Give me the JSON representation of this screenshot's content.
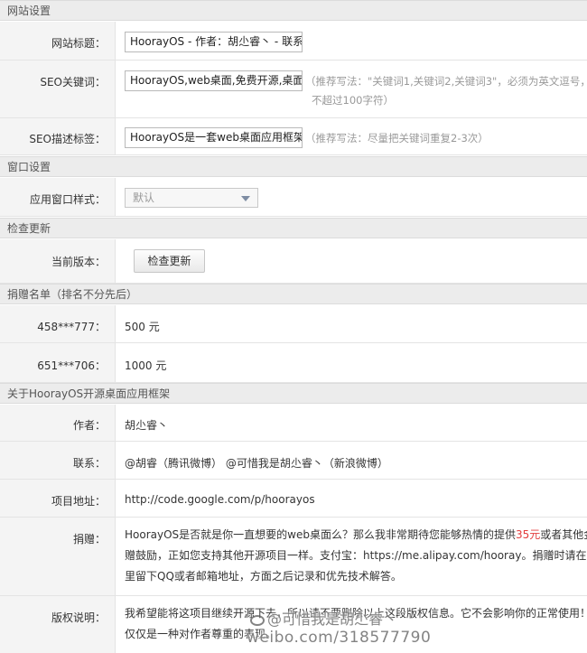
{
  "sections": {
    "site": "网站设置",
    "window": "窗口设置",
    "update": "检查更新",
    "donors": "捐赠名单（排名不分先后）",
    "about": "关于HoorayOS开源桌面应用框架"
  },
  "site": {
    "title_label": "网站标题：",
    "title_value": "HoorayOS - 作者：胡尐睿丶 - 联系方式",
    "keywords_label": "SEO关键词：",
    "keywords_value": "HoorayOS,web桌面,免费开源,桌面管理",
    "keywords_hint_1": "（推荐写法：\"关键词1,关键词2,关键词3\"，必须为英文逗号，",
    "keywords_hint_2": "不超过100字符）",
    "desc_label": "SEO描述标签：",
    "desc_value": "HoorayOS是一套web桌面应用框架，",
    "desc_hint": "（推荐写法：尽量把关键词重复2-3次）"
  },
  "window": {
    "style_label": "应用窗口样式：",
    "style_value": "默认"
  },
  "update": {
    "version_label": "当前版本：",
    "check_button": "检查更新"
  },
  "donors": [
    {
      "name": "458***777：",
      "amount": "500 元"
    },
    {
      "name": "651***706：",
      "amount": "1000 元"
    }
  ],
  "about": {
    "author_label": "作者：",
    "author_value": "胡尐睿丶",
    "contact_label": "联系：",
    "contact_value": "@胡睿（腾讯微博） @可惜我是胡尐睿丶（新浪微博）",
    "project_label": "项目地址：",
    "project_value": "http://code.google.com/p/hoorayos",
    "donate_label": "捐赠：",
    "donate_line1_a": "HoorayOS是否就是你一直想要的web桌面么？那么我非常期待您能够热情的提供",
    "donate_line1_red": "35元",
    "donate_line1_b": "或者其他金额的捐赠",
    "donate_line2": "赠鼓励，正如您支持其他开源项目一样。支付宝：https://me.alipay.com/hooray。捐赠时请在付款说明",
    "donate_line3": "里留下QQ或者邮箱地址，方面之后记录和优先技术解答。",
    "copyright_label": "版权说明：",
    "copyright_line1": "我希望能将这项目继续开源下去，所以请不要删除以上这段版权信息。它不会影响你的正常使用！",
    "copyright_line2": "仅仅是一种对作者尊重的表现。"
  },
  "watermark": {
    "handle": "@可惜我是胡尐睿丶",
    "url": "weibo.com/318577790"
  }
}
